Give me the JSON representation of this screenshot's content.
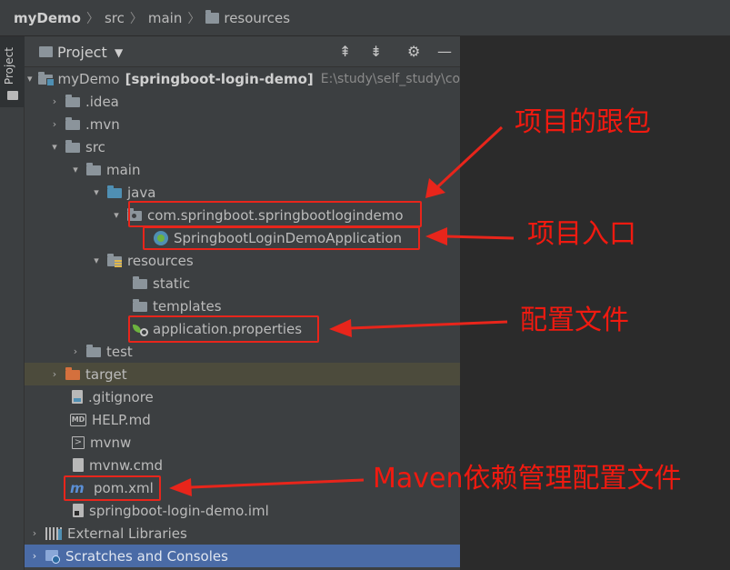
{
  "breadcrumb": {
    "items": [
      "myDemo",
      "src",
      "main",
      "resources"
    ]
  },
  "stripe": {
    "label": "Project"
  },
  "panel": {
    "title": "Project"
  },
  "tree": [
    {
      "name": "tree-item-mydemo",
      "arrow": "▾",
      "icon": "module-folder-icon",
      "label": "myDemo",
      "bold": "[springboot-login-demo]",
      "path": "E:\\study\\self_study\\co"
    },
    {
      "name": "tree-item-idea",
      "arrow": "›",
      "icon": "folder-icon",
      "label": ".idea"
    },
    {
      "name": "tree-item-mvn",
      "arrow": "›",
      "icon": "folder-icon",
      "label": ".mvn"
    },
    {
      "name": "tree-item-src",
      "arrow": "▾",
      "icon": "folder-icon",
      "label": "src"
    },
    {
      "name": "tree-item-main",
      "arrow": "▾",
      "icon": "folder-icon",
      "label": "main"
    },
    {
      "name": "tree-item-java",
      "arrow": "▾",
      "icon": "source-folder-icon",
      "label": "java"
    },
    {
      "name": "tree-item-package",
      "arrow": "▾",
      "icon": "package-icon",
      "label": "com.springboot.springbootlogindemo"
    },
    {
      "name": "tree-item-application-class",
      "arrow": "",
      "icon": "spring-boot-class-icon",
      "label": "SpringbootLoginDemoApplication"
    },
    {
      "name": "tree-item-resources",
      "arrow": "▾",
      "icon": "resources-folder-icon",
      "label": "resources"
    },
    {
      "name": "tree-item-static",
      "arrow": "",
      "icon": "folder-icon",
      "label": "static"
    },
    {
      "name": "tree-item-templates",
      "arrow": "",
      "icon": "folder-icon",
      "label": "templates"
    },
    {
      "name": "tree-item-application-properties",
      "arrow": "",
      "icon": "properties-file-icon",
      "label": "application.properties"
    },
    {
      "name": "tree-item-test",
      "arrow": "›",
      "icon": "folder-icon",
      "label": "test"
    },
    {
      "name": "tree-item-target",
      "arrow": "›",
      "icon": "excluded-folder-icon",
      "label": "target"
    },
    {
      "name": "tree-item-gitignore",
      "arrow": "",
      "icon": "text-file-icon",
      "label": ".gitignore"
    },
    {
      "name": "tree-item-help-md",
      "arrow": "",
      "icon": "markdown-file-icon",
      "label": "HELP.md"
    },
    {
      "name": "tree-item-mvnw",
      "arrow": "",
      "icon": "shell-file-icon",
      "label": "mvnw"
    },
    {
      "name": "tree-item-mvnw-cmd",
      "arrow": "",
      "icon": "cmd-file-icon",
      "label": "mvnw.cmd"
    },
    {
      "name": "tree-item-pom-xml",
      "arrow": "",
      "icon": "maven-icon",
      "label": "pom.xml"
    },
    {
      "name": "tree-item-iml",
      "arrow": "",
      "icon": "module-file-icon",
      "label": "springboot-login-demo.iml"
    },
    {
      "name": "tree-item-external-libraries",
      "arrow": "›",
      "icon": "libraries-icon",
      "label": "External Libraries"
    },
    {
      "name": "tree-item-scratches",
      "arrow": "›",
      "icon": "scratches-icon",
      "label": "Scratches and Consoles"
    }
  ],
  "annotations": {
    "root_package": "项目的跟包",
    "entry": "项目入口",
    "config": "配置文件",
    "maven": "Maven依赖管理配置文件"
  },
  "colors": {
    "annotation": "#e8251b",
    "selection": "#4a6ba6",
    "excluded_row": "#4c4b3c"
  }
}
